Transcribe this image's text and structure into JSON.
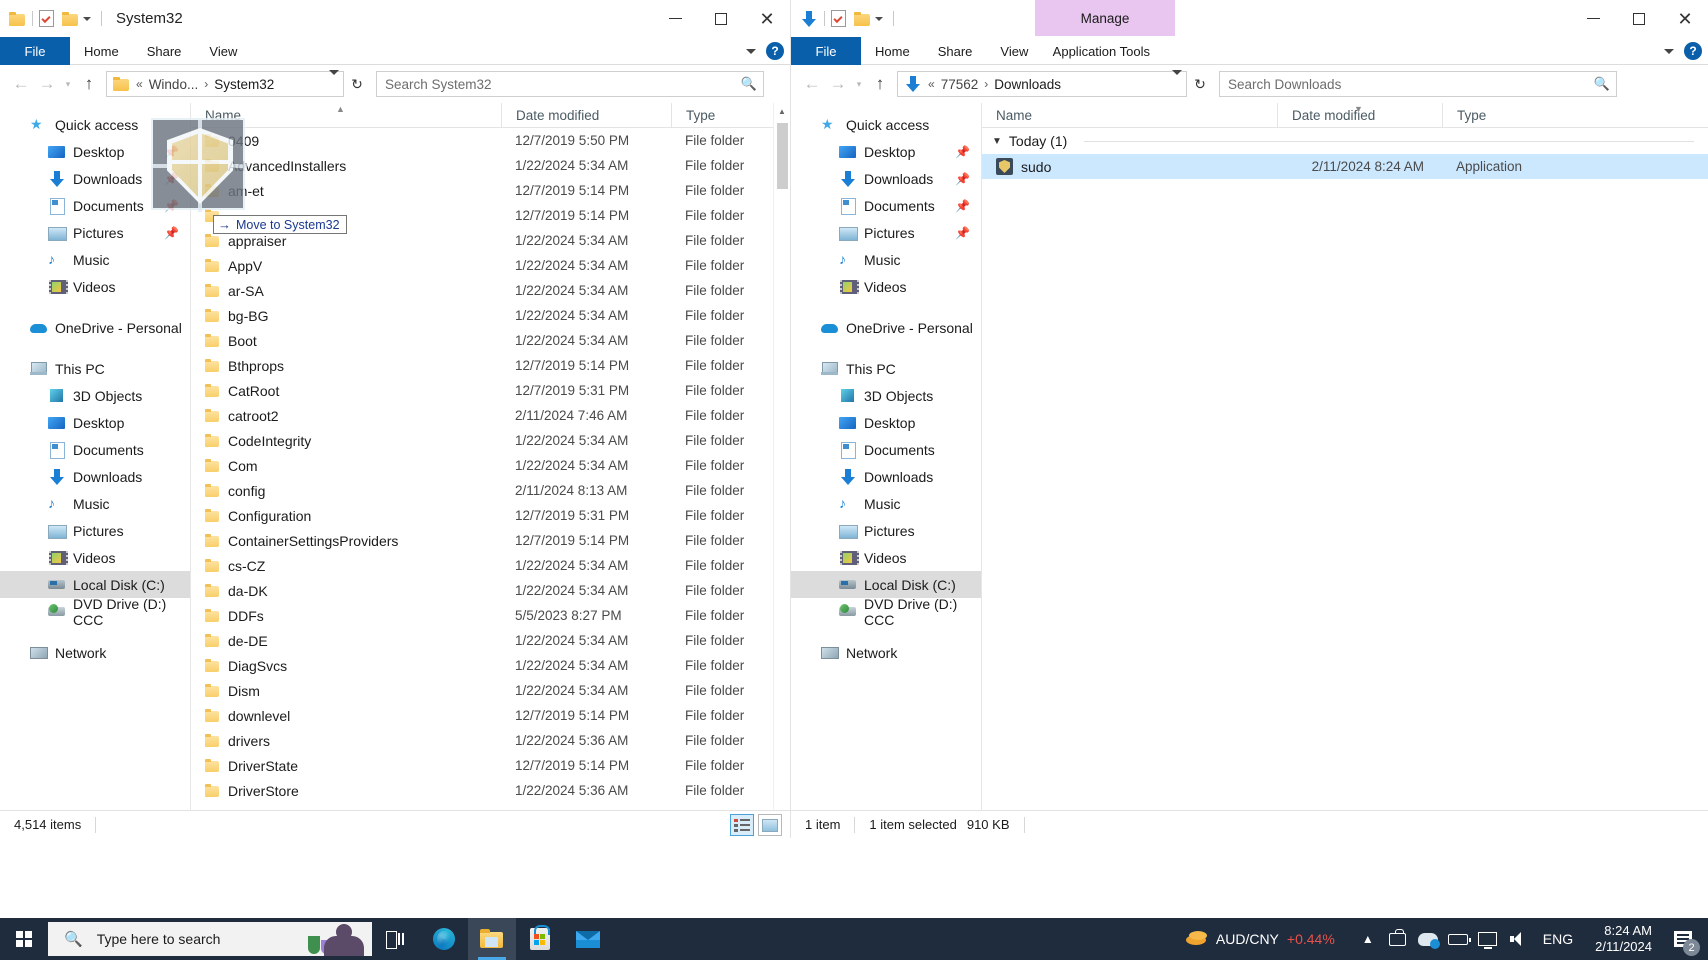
{
  "windows": {
    "left": {
      "title": "System32",
      "quick_access_toolbar": {
        "folder_icon": "folder-icon",
        "properties_icon": "checked-document-icon",
        "new_folder_icon": "folder-icon",
        "customize_icon": "chevron-down-icon"
      },
      "controls": {
        "minimize": "minimize-icon",
        "maximize": "maximize-icon",
        "close": "close-icon"
      },
      "ribbon_tabs": [
        "File",
        "Home",
        "Share",
        "View"
      ],
      "ribbon_help": "?",
      "address": {
        "back": "back-arrow-icon",
        "forward": "forward-arrow-icon",
        "recent": "chevron-down-icon",
        "up": "up-arrow-icon",
        "crumbs": [
          "Windo...",
          "System32"
        ],
        "separator": "›",
        "prefix": "«",
        "dropdown": "chevron-down-icon",
        "refresh": "↻"
      },
      "search_placeholder": "Search System32",
      "columns": [
        "Name",
        "Date modified",
        "Type"
      ],
      "sort_column": "Name",
      "rows": [
        {
          "name": "0409",
          "date": "12/7/2019 5:50 PM",
          "type": "File folder"
        },
        {
          "name": "AdvancedInstallers",
          "date": "1/22/2024 5:34 AM",
          "type": "File folder"
        },
        {
          "name": "am-et",
          "date": "12/7/2019 5:14 PM",
          "type": "File folder"
        },
        {
          "name": "",
          "date": "12/7/2019 5:14 PM",
          "type": "File folder"
        },
        {
          "name": "appraiser",
          "date": "1/22/2024 5:34 AM",
          "type": "File folder"
        },
        {
          "name": "AppV",
          "date": "1/22/2024 5:34 AM",
          "type": "File folder"
        },
        {
          "name": "ar-SA",
          "date": "1/22/2024 5:34 AM",
          "type": "File folder"
        },
        {
          "name": "bg-BG",
          "date": "1/22/2024 5:34 AM",
          "type": "File folder"
        },
        {
          "name": "Boot",
          "date": "1/22/2024 5:34 AM",
          "type": "File folder"
        },
        {
          "name": "Bthprops",
          "date": "12/7/2019 5:14 PM",
          "type": "File folder"
        },
        {
          "name": "CatRoot",
          "date": "12/7/2019 5:31 PM",
          "type": "File folder"
        },
        {
          "name": "catroot2",
          "date": "2/11/2024 7:46 AM",
          "type": "File folder"
        },
        {
          "name": "CodeIntegrity",
          "date": "1/22/2024 5:34 AM",
          "type": "File folder"
        },
        {
          "name": "Com",
          "date": "1/22/2024 5:34 AM",
          "type": "File folder"
        },
        {
          "name": "config",
          "date": "2/11/2024 8:13 AM",
          "type": "File folder"
        },
        {
          "name": "Configuration",
          "date": "12/7/2019 5:31 PM",
          "type": "File folder"
        },
        {
          "name": "ContainerSettingsProviders",
          "date": "12/7/2019 5:14 PM",
          "type": "File folder"
        },
        {
          "name": "cs-CZ",
          "date": "1/22/2024 5:34 AM",
          "type": "File folder"
        },
        {
          "name": "da-DK",
          "date": "1/22/2024 5:34 AM",
          "type": "File folder"
        },
        {
          "name": "DDFs",
          "date": "5/5/2023 8:27 PM",
          "type": "File folder"
        },
        {
          "name": "de-DE",
          "date": "1/22/2024 5:34 AM",
          "type": "File folder"
        },
        {
          "name": "DiagSvcs",
          "date": "1/22/2024 5:34 AM",
          "type": "File folder"
        },
        {
          "name": "Dism",
          "date": "1/22/2024 5:34 AM",
          "type": "File folder"
        },
        {
          "name": "downlevel",
          "date": "12/7/2019 5:14 PM",
          "type": "File folder"
        },
        {
          "name": "drivers",
          "date": "1/22/2024 5:36 AM",
          "type": "File folder"
        },
        {
          "name": "DriverState",
          "date": "12/7/2019 5:14 PM",
          "type": "File folder"
        },
        {
          "name": "DriverStore",
          "date": "1/22/2024 5:36 AM",
          "type": "File folder"
        }
      ],
      "status": {
        "items": "4,514 items"
      },
      "view_buttons": {
        "details": "details-view-icon",
        "tiles": "large-icons-view-icon"
      }
    },
    "right": {
      "title": "Downloads",
      "contextual_tab": "Manage",
      "quick_access_toolbar": {
        "download_icon": "download-arrow-icon",
        "properties_icon": "checked-document-icon",
        "new_folder_icon": "folder-icon",
        "customize_icon": "chevron-down-icon"
      },
      "controls": {
        "minimize": "minimize-icon",
        "maximize": "maximize-icon",
        "close": "close-icon"
      },
      "ribbon_tabs": [
        "File",
        "Home",
        "Share",
        "View",
        "Application Tools"
      ],
      "ribbon_help": "?",
      "address": {
        "crumbs": [
          "77562",
          "Downloads"
        ],
        "prefix": "«",
        "separator": "›",
        "refresh": "↻"
      },
      "search_placeholder": "Search Downloads",
      "columns": [
        "Name",
        "Date modified",
        "Type"
      ],
      "sort_column": "Date modified",
      "group_header": "Today (1)",
      "rows": [
        {
          "name": "sudo",
          "date": "2/11/2024 8:24 AM",
          "type": "Application",
          "icon": "shield-icon",
          "selected": true
        }
      ],
      "status": {
        "items": "1 item",
        "selection": "1 item selected",
        "size": "910 KB"
      },
      "view_buttons": {
        "details": "details-view-icon",
        "tiles": "large-icons-view-icon"
      }
    }
  },
  "nav_pane": {
    "groups": [
      {
        "label": "Quick access",
        "icon": "star-icon",
        "pinned": false,
        "children": [
          {
            "label": "Desktop",
            "icon": "desktop-icon",
            "pinned": true
          },
          {
            "label": "Downloads",
            "icon": "download-icon",
            "pinned": true
          },
          {
            "label": "Documents",
            "icon": "documents-icon",
            "pinned": true
          },
          {
            "label": "Pictures",
            "icon": "pictures-icon",
            "pinned": true
          },
          {
            "label": "Music",
            "icon": "music-icon",
            "pinned": false
          },
          {
            "label": "Videos",
            "icon": "videos-icon",
            "pinned": false
          }
        ]
      },
      {
        "label": "OneDrive - Personal",
        "icon": "onedrive-icon",
        "children": []
      },
      {
        "label": "This PC",
        "icon": "this-pc-icon",
        "children": [
          {
            "label": "3D Objects",
            "icon": "3d-objects-icon"
          },
          {
            "label": "Desktop",
            "icon": "desktop-icon"
          },
          {
            "label": "Documents",
            "icon": "documents-icon"
          },
          {
            "label": "Downloads",
            "icon": "download-icon"
          },
          {
            "label": "Music",
            "icon": "music-icon"
          },
          {
            "label": "Pictures",
            "icon": "pictures-icon"
          },
          {
            "label": "Videos",
            "icon": "videos-icon"
          },
          {
            "label": "Local Disk (C:)",
            "icon": "local-disk-icon",
            "selected": true
          },
          {
            "label": "DVD Drive (D:) CCC",
            "icon": "dvd-drive-icon"
          }
        ]
      },
      {
        "label": "Network",
        "icon": "network-icon",
        "children": []
      }
    ]
  },
  "drag": {
    "tooltip": "Move to System32",
    "tooltip_arrow": "→",
    "ghost_icon": "shield-icon"
  },
  "taskbar": {
    "start": "windows-logo-icon",
    "search_placeholder": "Type here to search",
    "task_view": "task-view-icon",
    "pinned": [
      {
        "name": "edge-icon"
      },
      {
        "name": "file-explorer-icon",
        "active": true
      },
      {
        "name": "microsoft-store-icon"
      },
      {
        "name": "mail-icon"
      }
    ],
    "ticker": {
      "pair": "AUD/CNY",
      "change": "+0.44%",
      "icon": "coin-icon",
      "change_color": "#e8514a"
    },
    "tray": {
      "show_hidden": "chevron-up-icon",
      "icons": [
        "camera-icon",
        "onedrive-icon",
        "battery-icon",
        "display-icon",
        "volume-icon"
      ],
      "language": "ENG",
      "time": "8:24 AM",
      "date": "2/11/2024",
      "notifications": "notifications-icon",
      "notification_count": "2"
    }
  },
  "colors": {
    "accent": "#0a5fab",
    "selection": "#cce8ff",
    "taskbar": "#1f2c3d",
    "contextual_tab": "#e8c6ef",
    "ticker_up": "#e8514a"
  }
}
